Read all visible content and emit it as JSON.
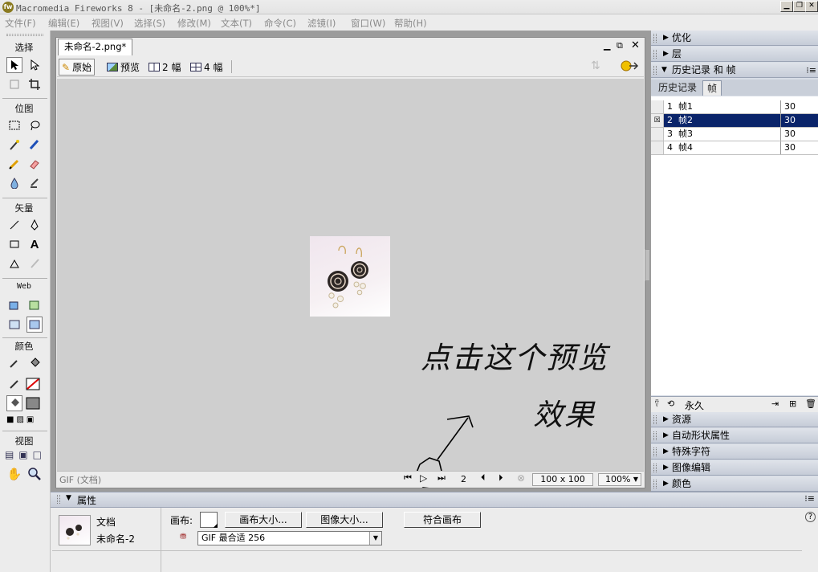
{
  "window": {
    "title": "Macromedia Fireworks 8 - [未命名-2.png @ 100%*]",
    "app_icon": "fw",
    "minimize_icon": "minimize-icon",
    "restore_icon": "restore-icon",
    "close_icon": "close-icon"
  },
  "menu": [
    "文件(F)",
    "编辑(E)",
    "视图(V)",
    "选择(S)",
    "修改(M)",
    "文本(T)",
    "命令(C)",
    "滤镜(I)",
    "窗口(W)",
    "帮助(H)"
  ],
  "tools": {
    "select_label": "选择",
    "bitmap_label": "位图",
    "vector_label": "矢量",
    "web_label": "Web",
    "colors_label": "颜色",
    "view_label": "视图"
  },
  "document": {
    "tab_title": "未命名-2.png*",
    "views": [
      "原始",
      "预览",
      "2 幅",
      "4 幅"
    ],
    "status_left": "GIF (文档)",
    "frame_number": "2",
    "size": "100 x 100",
    "zoom": "100%"
  },
  "annotation": {
    "line1": "点击这个预览",
    "line2": "效果"
  },
  "right_panels": {
    "optimize": "优化",
    "layers": "层",
    "history_frames": "历史记录 和 帧",
    "tabs": [
      "历史记录",
      "帧"
    ],
    "frames": [
      {
        "num": "1",
        "name": "帧1",
        "delay": "30"
      },
      {
        "num": "2",
        "name": "帧2",
        "delay": "30"
      },
      {
        "num": "3",
        "name": "帧3",
        "delay": "30"
      },
      {
        "num": "4",
        "name": "帧4",
        "delay": "30"
      }
    ],
    "loop": "永久",
    "assets": "资源",
    "auto_shape": "自动形状属性",
    "special_chars": "特殊字符",
    "image_edit": "图像编辑",
    "colors": "颜色"
  },
  "properties": {
    "title": "属性",
    "doc_type": "文档",
    "doc_name": "未命名-2",
    "canvas_label": "画布:",
    "canvas_size_btn": "画布大小...",
    "image_size_btn": "图像大小...",
    "fit_canvas_btn": "符合画布",
    "export_setting": "GIF 最合适 256",
    "help": "?"
  },
  "colors": {
    "selection": "#0a246a",
    "panel_header": "#c6ccd8",
    "canvas_bg": "#cfcfcf"
  }
}
